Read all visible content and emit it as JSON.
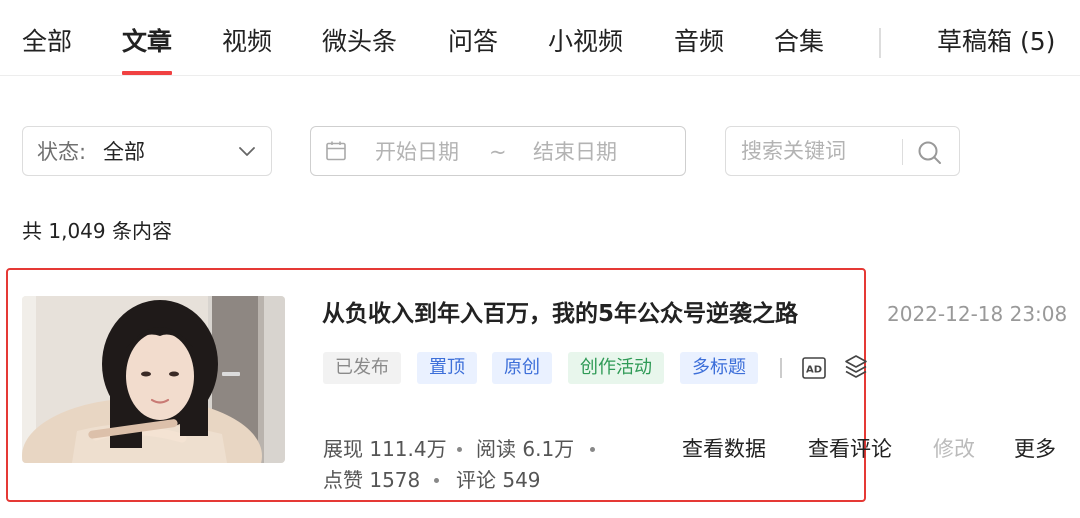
{
  "tabs": [
    {
      "label": "全部",
      "active": false
    },
    {
      "label": "文章",
      "active": true
    },
    {
      "label": "视频",
      "active": false
    },
    {
      "label": "微头条",
      "active": false
    },
    {
      "label": "问答",
      "active": false
    },
    {
      "label": "小视频",
      "active": false
    },
    {
      "label": "音频",
      "active": false
    },
    {
      "label": "合集",
      "active": false
    },
    {
      "label": "草稿箱 (5)",
      "active": false
    }
  ],
  "filters": {
    "status_prefix": "状态:",
    "status_value": "全部",
    "date_start_placeholder": "开始日期",
    "date_separator": "~",
    "date_end_placeholder": "结束日期",
    "search_placeholder": "搜索关键词"
  },
  "total_label": "共 1,049 条内容",
  "article": {
    "title": "从负收入到年入百万，我的5年公众号逆袭之路",
    "publish_time": "2022-12-18 23:08",
    "tags": [
      "已发布",
      "置顶",
      "原创",
      "创作活动",
      "多标题"
    ],
    "ad_badge": "AD",
    "stats": {
      "impressions": "展现 111.4万",
      "reads": "阅读 6.1万",
      "likes": "点赞 1578",
      "comments": "评论 549"
    },
    "actions": [
      "查看数据",
      "查看评论",
      "修改",
      "更多"
    ]
  },
  "colors": {
    "accent": "#f04142",
    "highlight_border": "#e53935",
    "tag_blue": "#3d6fd9",
    "tag_green": "#2f9a56",
    "tag_gray": "#8a8a8a"
  },
  "icons": [
    "chevron-down-icon",
    "calendar-icon",
    "search-icon",
    "ad-icon",
    "layers-icon"
  ]
}
